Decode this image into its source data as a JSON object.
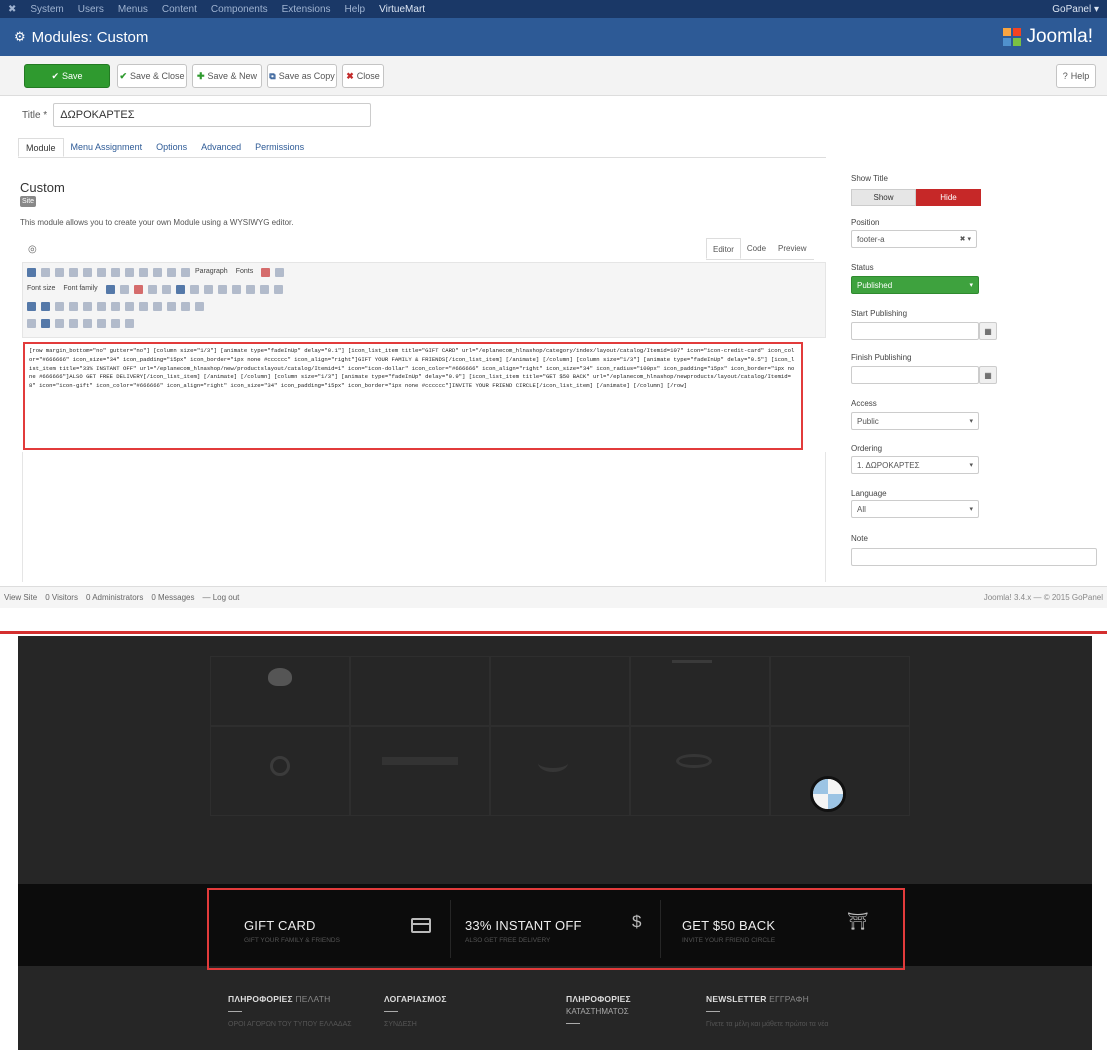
{
  "topbar": {
    "menu": [
      "System",
      "Users",
      "Menus",
      "Content",
      "Components",
      "Extensions",
      "Help",
      "VirtueMart"
    ],
    "user": "GoPanel ▾"
  },
  "header": {
    "title": "Modules: Custom",
    "brand": "Joomla!"
  },
  "toolbar": {
    "save": "Save",
    "save_close": "Save & Close",
    "save_new": "Save & New",
    "save_copy": "Save as Copy",
    "close": "Close",
    "help": "Help"
  },
  "form": {
    "title_label": "Title *",
    "title_value": "ΔΩΡΟΚΑΡΤΕΣ",
    "tabs": [
      "Module",
      "Menu Assignment",
      "Options",
      "Advanced",
      "Permissions"
    ],
    "module_name": "Custom",
    "site_badge": "Site",
    "description": "This module allows you to create your own Module using a WYSIWYG editor."
  },
  "editor": {
    "tabs": [
      "Editor",
      "Code",
      "Preview"
    ],
    "format_select": "Paragraph",
    "font_select": "Fonts",
    "size_select": "Font size",
    "family_select": "Font family",
    "code": "[row margin_bottom=\"no\" gutter=\"no\"] [column size=\"1/3\"] [animate type=\"fadeInUp\" delay=\"0.1\"] [icon_list_item title=\"GIFT CARD\" url=\"/eplanecom_hlnashop/category/index/layout/catalog/Itemid=107\" icon=\"icon-credit-card\" icon_color=\"#666666\" icon_size=\"34\" icon_padding=\"15px\" icon_border=\"1px none #cccccc\" icon_align=\"right\"]GIFT YOUR FAMILY & FRIENDS[/icon_list_item] [/animate] [/column] [column size=\"1/3\"] [animate type=\"fadeInUp\" delay=\"0.5\"] [icon_list_item title=\"33% INSTANT OFF\" url=\"/eplanecom_hlnashop/new/productslayout/catalog/Itemid=1\" icon=\"icon-dollar\" icon_color=\"#666666\" icon_align=\"right\" icon_size=\"34\" icon_radius=\"100px\" icon_padding=\"15px\" icon_border=\"1px none #666666\"]ALSO GET FREE DELIVERY[/icon_list_item] [/animate] [/column] [column size=\"1/3\"] [animate type=\"fadeInUp\" delay=\"0.9\"] [icon_list_item title=\"GET $50 BACK\" url=\"/eplanecom_hlnashop/newproducts/layout/catalog/Itemid=8\" icon=\"icon-gift\" icon_color=\"#666666\" icon_align=\"right\" icon_size=\"34\" icon_padding=\"15px\" icon_border=\"1px none #cccccc\"]INVITE YOUR FRIEND CIRCLE[/icon_list_item] [/animate] [/column] [/row]"
  },
  "sidebar": {
    "show_title_label": "Show Title",
    "show_label": "Show",
    "hide_label": "Hide",
    "position_label": "Position",
    "position_value": "footer-a",
    "status_label": "Status",
    "status_value": "Published",
    "start_pub_label": "Start Publishing",
    "finish_pub_label": "Finish Publishing",
    "access_label": "Access",
    "access_value": "Public",
    "ordering_label": "Ordering",
    "ordering_value": "1. ΔΩΡΟΚΑΡΤΕΣ",
    "language_label": "Language",
    "language_value": "All",
    "note_label": "Note"
  },
  "statusbar": {
    "items": [
      "View Site",
      "0 Visitors",
      "0 Administrators",
      "0 Messages",
      "— Log out"
    ],
    "version": "Joomla! 3.4.x — © 2015 GoPanel"
  },
  "promo": {
    "items": [
      {
        "title": "GIFT CARD",
        "subtitle": "GIFT YOUR FAMILY & FRIENDS",
        "icon": "credit-card-icon"
      },
      {
        "title": "33% INSTANT OFF",
        "subtitle": "ALSO GET FREE DELIVERY",
        "icon": "dollar-icon"
      },
      {
        "title": "GET $50 BACK",
        "subtitle": "INVITE YOUR FRIEND CIRCLE",
        "icon": "gift-icon"
      }
    ]
  },
  "footer": {
    "col1": {
      "title": "ΠΛΗΡΟΦΟΡΙΕΣ",
      "title_thin": "ΠΕΛΑΤΗ",
      "link": "ΟΡΟΙ ΑΓΟΡΩΝ ΤΟΥ ΤΥΠΟΥ ΕΛΛΑΔΑΣ"
    },
    "col2": {
      "title": "ΛΟΓΑΡΙΑΣΜΟΣ",
      "link": "ΣΥΝΔΕΣΗ"
    },
    "col3": {
      "title": "ΠΛΗΡΟΦΟΡΙΕΣ",
      "subtitle": "ΚΑΤΑΣΤΗΜΑΤΟΣ"
    },
    "col4": {
      "title": "NEWSLETTER",
      "title_thin": "ΕΓΓΡΑΦΗ",
      "text": "Γίνετε τα μέλη και μάθετε πρώτοι τα νέα"
    }
  },
  "colors": {
    "admin_header": "#2d5a96",
    "save_green": "#2f9a2f",
    "hide_red": "#c62828",
    "highlight_red": "#e23b3b",
    "site_dark": "#262626"
  }
}
